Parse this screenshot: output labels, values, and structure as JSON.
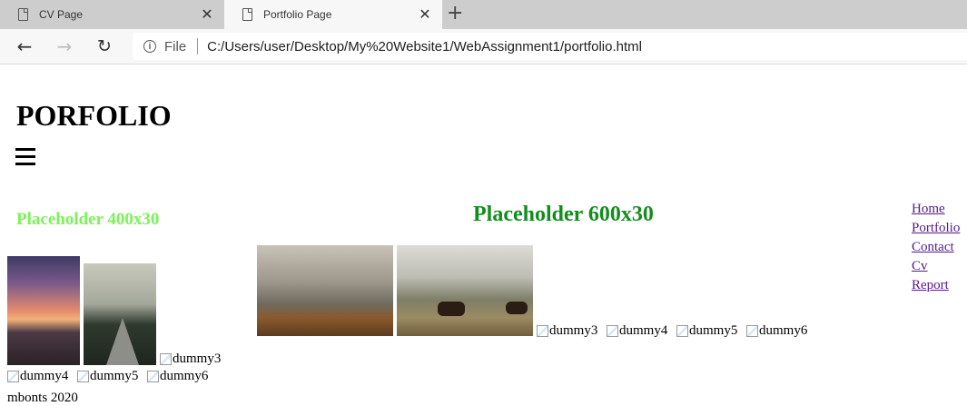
{
  "browser": {
    "tabs": [
      {
        "label": "CV Page"
      },
      {
        "label": "Portfolio Page"
      }
    ],
    "address": {
      "scheme_label": "File",
      "url": "C:/Users/user/Desktop/My%20Website1/WebAssignment1/portfolio.html"
    }
  },
  "page": {
    "title": "PORFOLIO",
    "placeholder_small": "Placeholder 400x30",
    "placeholder_large": "Placeholder 600x30",
    "nav": [
      "Home",
      "Portfolio",
      "Contact",
      "Cv",
      "Report"
    ],
    "left_gallery_alts": [
      "dummy3",
      "dummy4",
      "dummy5",
      "dummy6"
    ],
    "right_gallery_alts": [
      "dummy3",
      "dummy4",
      "dummy5",
      "dummy6"
    ],
    "footer": "mbonts 2020"
  }
}
